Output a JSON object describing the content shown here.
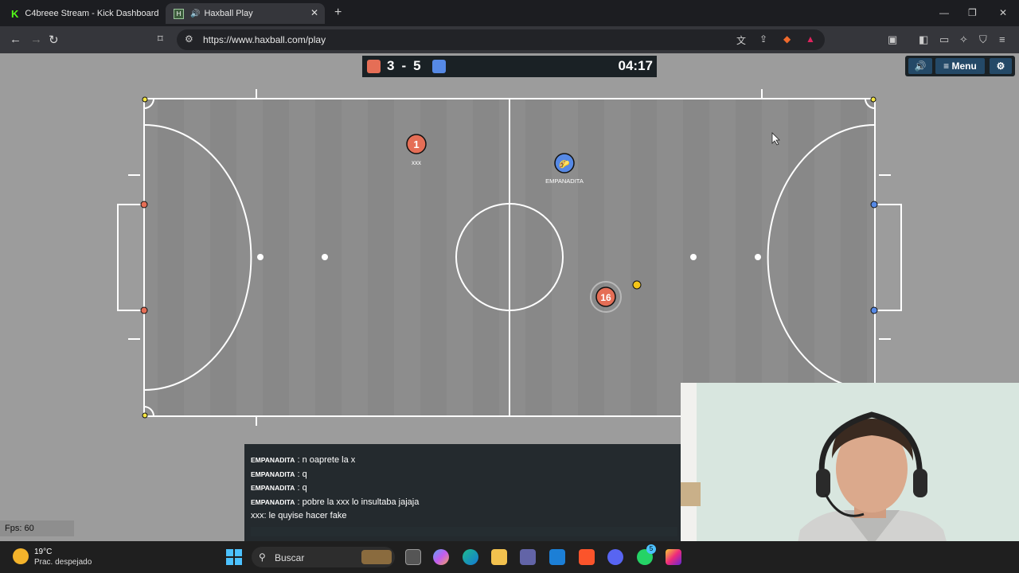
{
  "browser": {
    "tabs": [
      {
        "title": "C4breee Stream - Kick Dashboard",
        "icon": "kick-icon"
      },
      {
        "title": "Haxball Play",
        "icon": "haxball-icon",
        "active": true
      }
    ],
    "url": "https://www.haxball.com/play"
  },
  "game": {
    "score": {
      "red": "3",
      "separator": "-",
      "blue": "5"
    },
    "timer": "04:17",
    "buttons": {
      "menu": "Menu"
    },
    "players": [
      {
        "number": "1",
        "name": "xxx",
        "team": "red"
      },
      {
        "avatar": "🌮",
        "name": "EMPANADITA",
        "team": "blue"
      },
      {
        "number": "16",
        "name": "",
        "team": "red"
      }
    ],
    "fps": "Fps: 60"
  },
  "chat": {
    "messages": [
      {
        "name": "EMPANADITA",
        "text": ": n oaprete la x"
      },
      {
        "name": "EMPANADITA",
        "text": ": q"
      },
      {
        "name": "EMPANADITA",
        "text": ": q"
      },
      {
        "name": "EMPANADITA",
        "text": ": pobre la xxx lo insultaba jajaja"
      },
      {
        "name": "",
        "text": "xxx: le quyise hacer fake"
      }
    ]
  },
  "taskbar": {
    "temperature": "19°C",
    "weather": "Prac. despejado",
    "search_placeholder": "Buscar",
    "whatsapp_badge": "5"
  },
  "colors": {
    "red_team": "#e56e56",
    "blue_team": "#5689e5",
    "pitch": "#8a8a8a",
    "ball": "#f5c518"
  }
}
